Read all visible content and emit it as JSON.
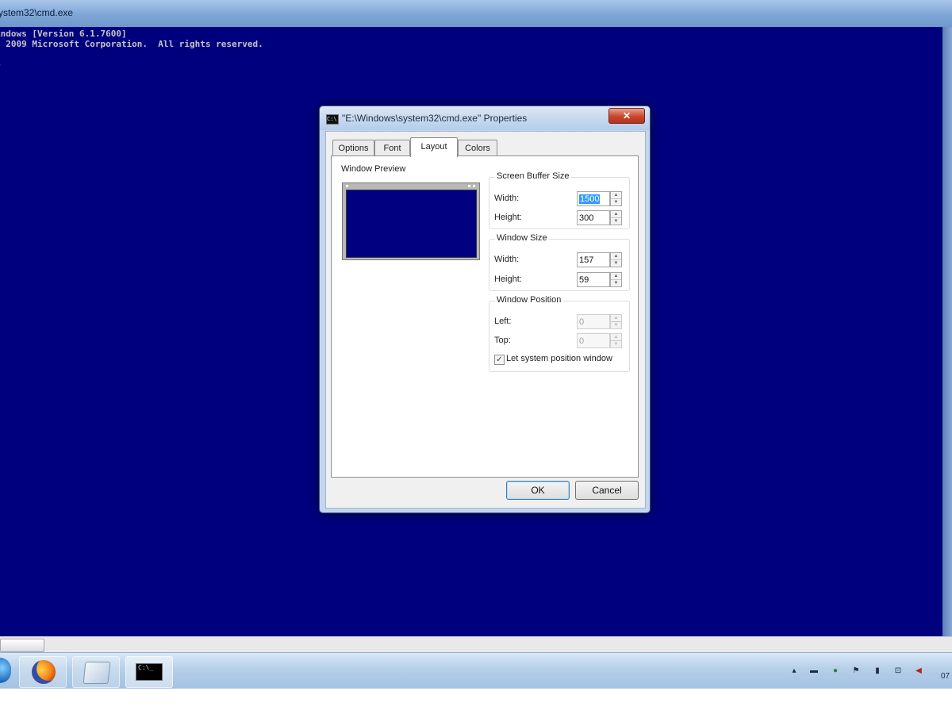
{
  "console": {
    "title": "ystem32\\cmd.exe",
    "lines": [
      "indows [Version 6.1.7600]",
      ") 2009 Microsoft Corporation.  All rights reserved.",
      "",
      ">"
    ],
    "background_color": "#00007f"
  },
  "dialog": {
    "title": "\"E:\\Windows\\system32\\cmd.exe\" Properties",
    "close_label": "✕",
    "tabs": [
      "Options",
      "Font",
      "Layout",
      "Colors"
    ],
    "active_tab": "Layout",
    "preview_label": "Window Preview",
    "screen_buffer": {
      "title": "Screen Buffer Size",
      "width_label": "Width:",
      "width_value": "1500",
      "height_label": "Height:",
      "height_value": "300"
    },
    "window_size": {
      "title": "Window Size",
      "width_label": "Width:",
      "width_value": "157",
      "height_label": "Height:",
      "height_value": "59"
    },
    "window_position": {
      "title": "Window Position",
      "left_label": "Left:",
      "left_value": "0",
      "top_label": "Top:",
      "top_value": "0",
      "checkbox_label": "Let system position window",
      "checkbox_checked": true
    },
    "ok_label": "OK",
    "cancel_label": "Cancel"
  },
  "taskbar": {
    "apps": [
      "firefox-icon",
      "windows-explorer-icon",
      "command-prompt-icon"
    ],
    "cmd_icon_text": "C:\\_",
    "tray": {
      "show_hidden_label": "▴",
      "clock_text": "07"
    }
  }
}
